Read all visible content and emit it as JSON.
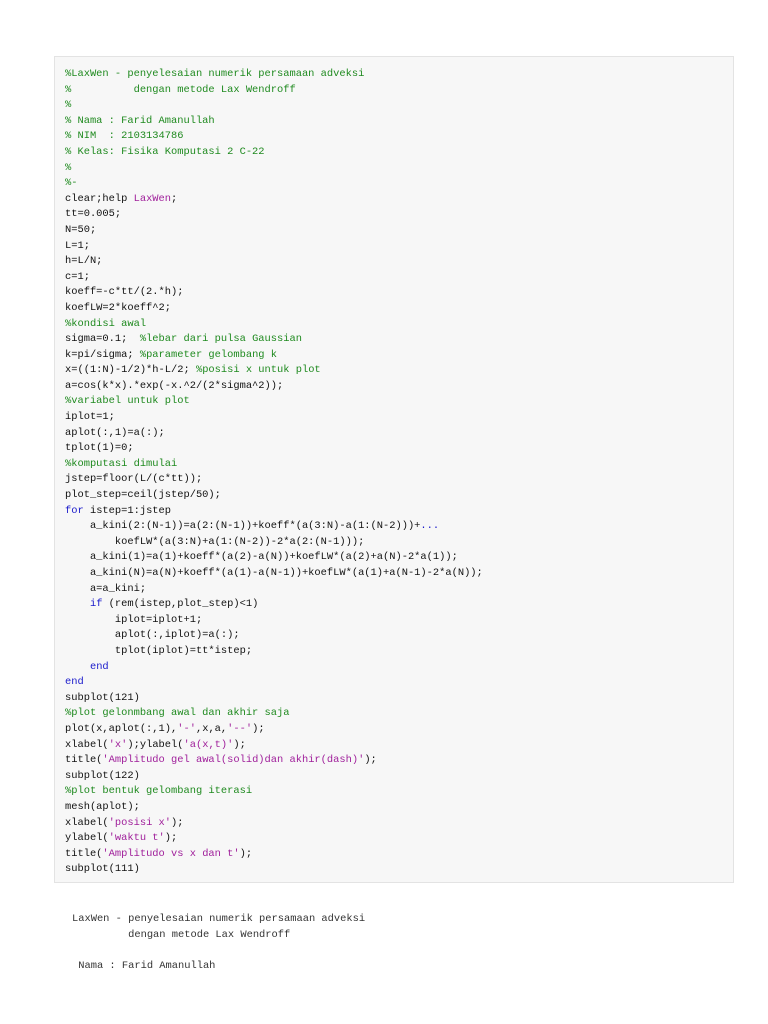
{
  "code_lines": [
    [
      {
        "t": "c",
        "s": "%LaxWen - penyelesaian numerik persamaan adveksi"
      }
    ],
    [
      {
        "t": "c",
        "s": "%          dengan metode Lax Wendroff"
      }
    ],
    [
      {
        "t": "c",
        "s": "%"
      }
    ],
    [
      {
        "t": "c",
        "s": "% Nama : Farid Amanullah"
      }
    ],
    [
      {
        "t": "c",
        "s": "% NIM  : 2103134786"
      }
    ],
    [
      {
        "t": "c",
        "s": "% Kelas: Fisika Komputasi 2 C-22"
      }
    ],
    [
      {
        "t": "c",
        "s": "%"
      }
    ],
    [
      {
        "t": "c",
        "s": "%-"
      }
    ],
    [
      {
        "t": "p",
        "s": "clear;help "
      },
      {
        "t": "s",
        "s": "LaxWen"
      },
      {
        "t": "p",
        "s": ";"
      }
    ],
    [
      {
        "t": "p",
        "s": "tt=0.005;"
      }
    ],
    [
      {
        "t": "p",
        "s": "N=50;"
      }
    ],
    [
      {
        "t": "p",
        "s": "L=1;"
      }
    ],
    [
      {
        "t": "p",
        "s": "h=L/N;"
      }
    ],
    [
      {
        "t": "p",
        "s": "c=1;"
      }
    ],
    [
      {
        "t": "p",
        "s": "koeff=-c*tt/(2.*h);"
      }
    ],
    [
      {
        "t": "p",
        "s": "koefLW=2*koeff^2;"
      }
    ],
    [
      {
        "t": "c",
        "s": "%kondisi awal"
      }
    ],
    [
      {
        "t": "p",
        "s": "sigma=0.1;  "
      },
      {
        "t": "c",
        "s": "%lebar dari pulsa Gaussian"
      }
    ],
    [
      {
        "t": "p",
        "s": "k=pi/sigma; "
      },
      {
        "t": "c",
        "s": "%parameter gelombang k"
      }
    ],
    [
      {
        "t": "p",
        "s": "x=((1:N)-1/2)*h-L/2; "
      },
      {
        "t": "c",
        "s": "%posisi x untuk plot"
      }
    ],
    [
      {
        "t": "p",
        "s": "a=cos(k*x).*exp(-x.^2/(2*sigma^2));"
      }
    ],
    [
      {
        "t": "c",
        "s": "%variabel untuk plot"
      }
    ],
    [
      {
        "t": "p",
        "s": "iplot=1;"
      }
    ],
    [
      {
        "t": "p",
        "s": "aplot(:,1)=a(:);"
      }
    ],
    [
      {
        "t": "p",
        "s": "tplot(1)=0;"
      }
    ],
    [
      {
        "t": "c",
        "s": "%komputasi dimulai"
      }
    ],
    [
      {
        "t": "p",
        "s": "jstep=floor(L/(c*tt));"
      }
    ],
    [
      {
        "t": "p",
        "s": "plot_step=ceil(jstep/50);"
      }
    ],
    [
      {
        "t": "k",
        "s": "for"
      },
      {
        "t": "p",
        "s": " istep=1:jstep"
      }
    ],
    [
      {
        "t": "p",
        "s": "    a_kini(2:(N-1))=a(2:(N-1))+koeff*(a(3:N)-a(1:(N-2)))+"
      },
      {
        "t": "k",
        "s": "..."
      }
    ],
    [
      {
        "t": "p",
        "s": "        koefLW*(a(3:N)+a(1:(N-2))-2*a(2:(N-1)));"
      }
    ],
    [
      {
        "t": "p",
        "s": "    a_kini(1)=a(1)+koeff*(a(2)-a(N))+koefLW*(a(2)+a(N)-2*a(1));"
      }
    ],
    [
      {
        "t": "p",
        "s": "    a_kini(N)=a(N)+koeff*(a(1)-a(N-1))+koefLW*(a(1)+a(N-1)-2*a(N));"
      }
    ],
    [
      {
        "t": "p",
        "s": "    a=a_kini;"
      }
    ],
    [
      {
        "t": "p",
        "s": "    "
      },
      {
        "t": "k",
        "s": "if"
      },
      {
        "t": "p",
        "s": " (rem(istep,plot_step)<1)"
      }
    ],
    [
      {
        "t": "p",
        "s": "        iplot=iplot+1;"
      }
    ],
    [
      {
        "t": "p",
        "s": "        aplot(:,iplot)=a(:);"
      }
    ],
    [
      {
        "t": "p",
        "s": "        tplot(iplot)=tt*istep;"
      }
    ],
    [
      {
        "t": "p",
        "s": "    "
      },
      {
        "t": "k",
        "s": "end"
      }
    ],
    [
      {
        "t": "k",
        "s": "end"
      }
    ],
    [
      {
        "t": "p",
        "s": "subplot(121)"
      }
    ],
    [
      {
        "t": "c",
        "s": "%plot gelonmbang awal dan akhir saja"
      }
    ],
    [
      {
        "t": "p",
        "s": "plot(x,aplot(:,1),"
      },
      {
        "t": "s",
        "s": "'-'"
      },
      {
        "t": "p",
        "s": ",x,a,"
      },
      {
        "t": "s",
        "s": "'--'"
      },
      {
        "t": "p",
        "s": ");"
      }
    ],
    [
      {
        "t": "p",
        "s": "xlabel("
      },
      {
        "t": "s",
        "s": "'x'"
      },
      {
        "t": "p",
        "s": ");ylabel("
      },
      {
        "t": "s",
        "s": "'a(x,t)'"
      },
      {
        "t": "p",
        "s": ");"
      }
    ],
    [
      {
        "t": "p",
        "s": "title("
      },
      {
        "t": "s",
        "s": "'Amplitudo gel awal(solid)dan akhir(dash)'"
      },
      {
        "t": "p",
        "s": ");"
      }
    ],
    [
      {
        "t": "p",
        "s": "subplot(122)"
      }
    ],
    [
      {
        "t": "c",
        "s": "%plot bentuk gelombang iterasi"
      }
    ],
    [
      {
        "t": "p",
        "s": "mesh(aplot);"
      }
    ],
    [
      {
        "t": "p",
        "s": "xlabel("
      },
      {
        "t": "s",
        "s": "'posisi x'"
      },
      {
        "t": "p",
        "s": ");"
      }
    ],
    [
      {
        "t": "p",
        "s": "ylabel("
      },
      {
        "t": "s",
        "s": "'waktu t'"
      },
      {
        "t": "p",
        "s": ");"
      }
    ],
    [
      {
        "t": "p",
        "s": "title("
      },
      {
        "t": "s",
        "s": "'Amplitudo vs x dan t'"
      },
      {
        "t": "p",
        "s": ");"
      }
    ],
    [
      {
        "t": "p",
        "s": "subplot(111)"
      }
    ]
  ],
  "output_lines": [
    "LaxWen - penyelesaian numerik persamaan adveksi",
    "         dengan metode Lax Wendroff",
    "",
    " Nama : Farid Amanullah"
  ]
}
